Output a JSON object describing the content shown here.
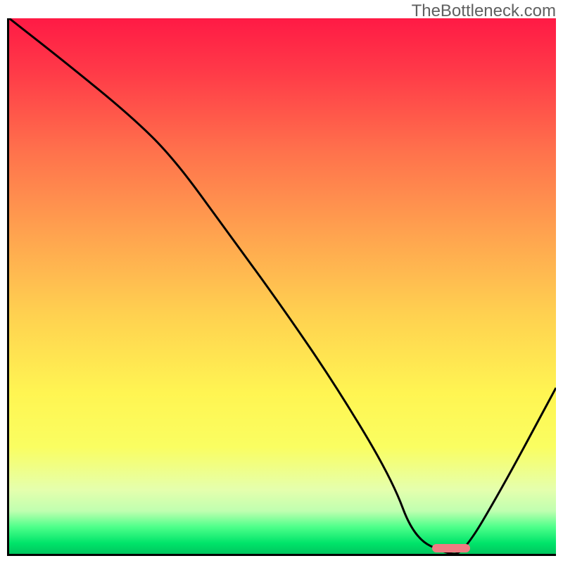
{
  "watermark": "TheBottleneck.com",
  "colors": {
    "gradient_top": "#ff1a45",
    "gradient_mid": "#ffd050",
    "gradient_bottom": "#00c65e",
    "axis": "#000000",
    "curve": "#000000",
    "marker": "#ef7b82"
  },
  "chart_data": {
    "type": "line",
    "title": "",
    "xlabel": "",
    "ylabel": "",
    "xlim": [
      0,
      100
    ],
    "ylim": [
      0,
      100
    ],
    "x": [
      0,
      10,
      22,
      30,
      40,
      50,
      60,
      70,
      74,
      80,
      83,
      90,
      100
    ],
    "values": [
      100,
      92,
      82,
      74,
      60,
      46,
      31,
      14,
      3,
      0,
      0,
      12,
      31
    ],
    "marker": {
      "x_start": 77,
      "x_end": 84,
      "y": 0
    },
    "annotations": []
  }
}
